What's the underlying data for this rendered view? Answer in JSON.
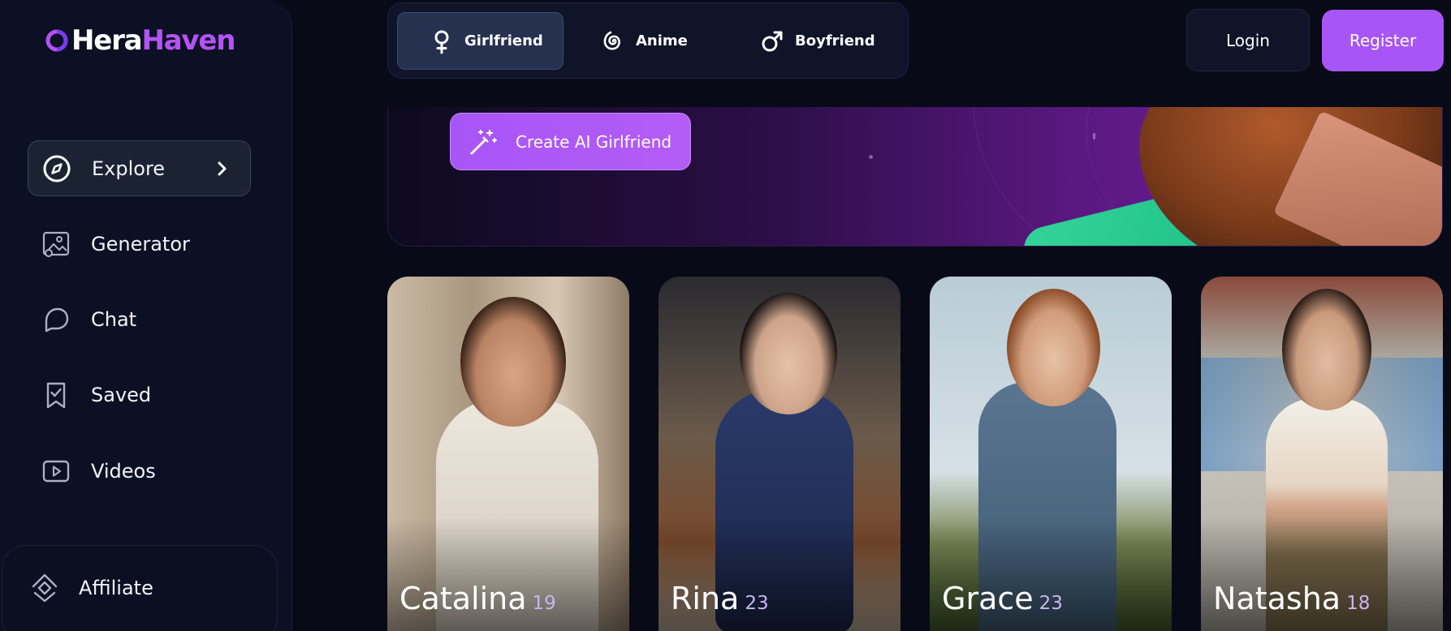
{
  "brand": {
    "name_part1": "Hera",
    "name_part2": "Haven",
    "accent": "#b453f5"
  },
  "sidebar": {
    "items": [
      {
        "label": "Explore",
        "icon": "compass-icon",
        "active": true
      },
      {
        "label": "Generator",
        "icon": "image-icon"
      },
      {
        "label": "Chat",
        "icon": "chat-bubble-icon"
      },
      {
        "label": "Saved",
        "icon": "bookmark-check-icon"
      },
      {
        "label": "Videos",
        "icon": "play-icon"
      }
    ],
    "affiliate": {
      "label": "Affiliate",
      "icon": "affiliate-icon"
    }
  },
  "tabs": [
    {
      "label": "Girlfriend",
      "icon": "female-icon",
      "active": true
    },
    {
      "label": "Anime",
      "icon": "spiral-icon"
    },
    {
      "label": "Boyfriend",
      "icon": "male-icon"
    }
  ],
  "auth": {
    "login_label": "Login",
    "register_label": "Register",
    "register_color": "#a855f7"
  },
  "banner": {
    "cta_label": "Create AI Girlfriend",
    "cta_icon": "magic-wand-icon"
  },
  "characters": [
    {
      "name": "Catalina",
      "age": "19"
    },
    {
      "name": "Rina",
      "age": "23"
    },
    {
      "name": "Grace",
      "age": "23"
    },
    {
      "name": "Natasha",
      "age": "18"
    }
  ]
}
